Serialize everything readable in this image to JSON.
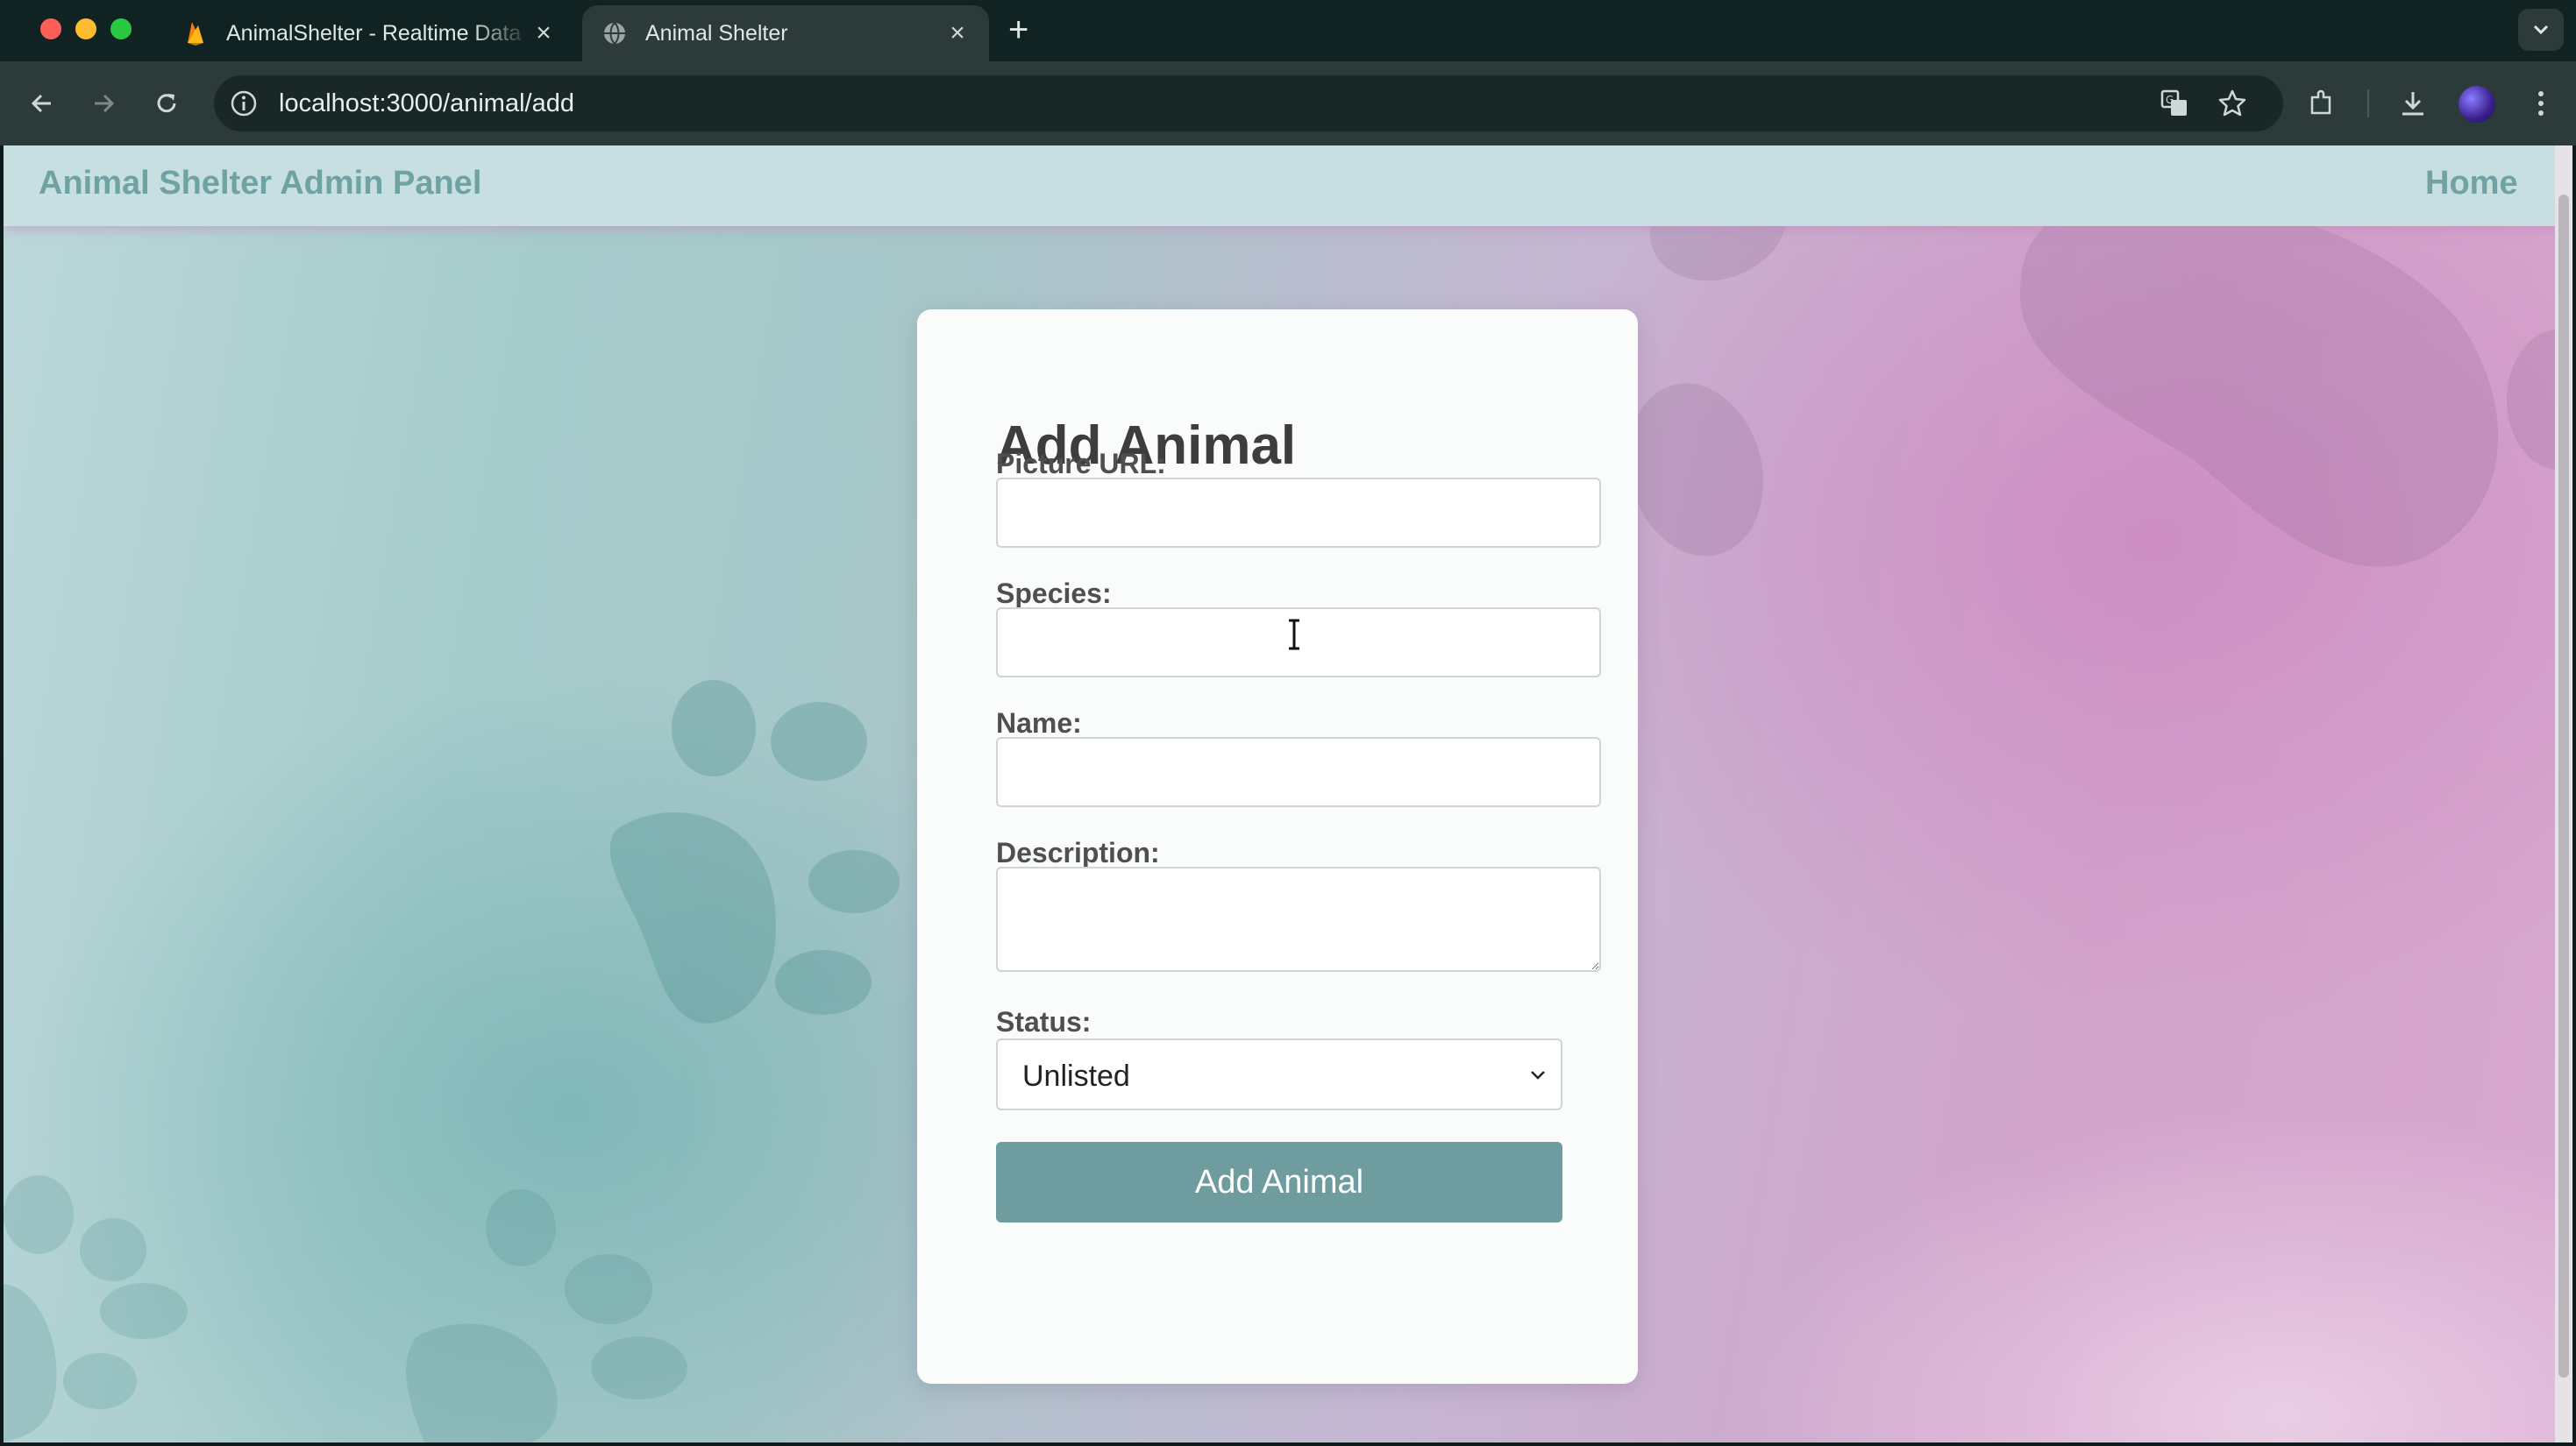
{
  "browser": {
    "tabs": [
      {
        "title": "AnimalShelter - Realtime Data",
        "favicon": "firebase-icon",
        "active": false
      },
      {
        "title": "Animal Shelter",
        "favicon": "globe-icon",
        "active": true
      }
    ],
    "url": "localhost:3000/animal/add"
  },
  "header": {
    "brand": "Animal Shelter Admin Panel",
    "home_link": "Home"
  },
  "form": {
    "title": "Add Animal",
    "fields": {
      "picture_url": {
        "label": "Picture URL:",
        "value": ""
      },
      "species": {
        "label": "Species:",
        "value": ""
      },
      "name": {
        "label": "Name:",
        "value": ""
      },
      "description": {
        "label": "Description:",
        "value": ""
      }
    },
    "status": {
      "label": "Status:",
      "selected": "Unlisted"
    },
    "submit_label": "Add Animal"
  },
  "colors": {
    "accent": "#6f9c9f",
    "brand_text": "#6fa2a3",
    "header_bg": "#c7dfe0"
  }
}
